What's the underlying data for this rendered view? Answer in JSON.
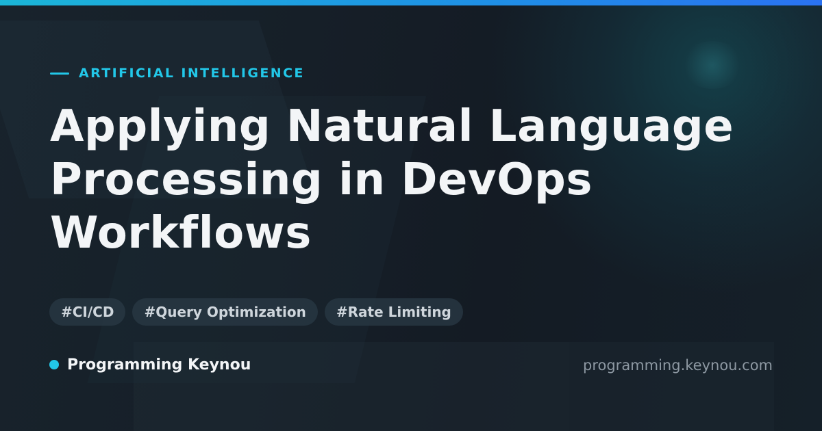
{
  "category": {
    "label": "ARTIFICIAL INTELLIGENCE"
  },
  "title": {
    "lines": [
      "Applying Natural Language",
      "Processing in DevOps",
      "Workflows"
    ]
  },
  "tags": [
    "#CI/CD",
    "#Query Optimization",
    "#Rate Limiting"
  ],
  "footer": {
    "brand": "Programming Keynou",
    "url": "programming.keynou.com"
  },
  "colors": {
    "accent": "#22c7e8",
    "background": "#141c24",
    "title": "#f3f5f7",
    "muted": "#8d98a2"
  }
}
